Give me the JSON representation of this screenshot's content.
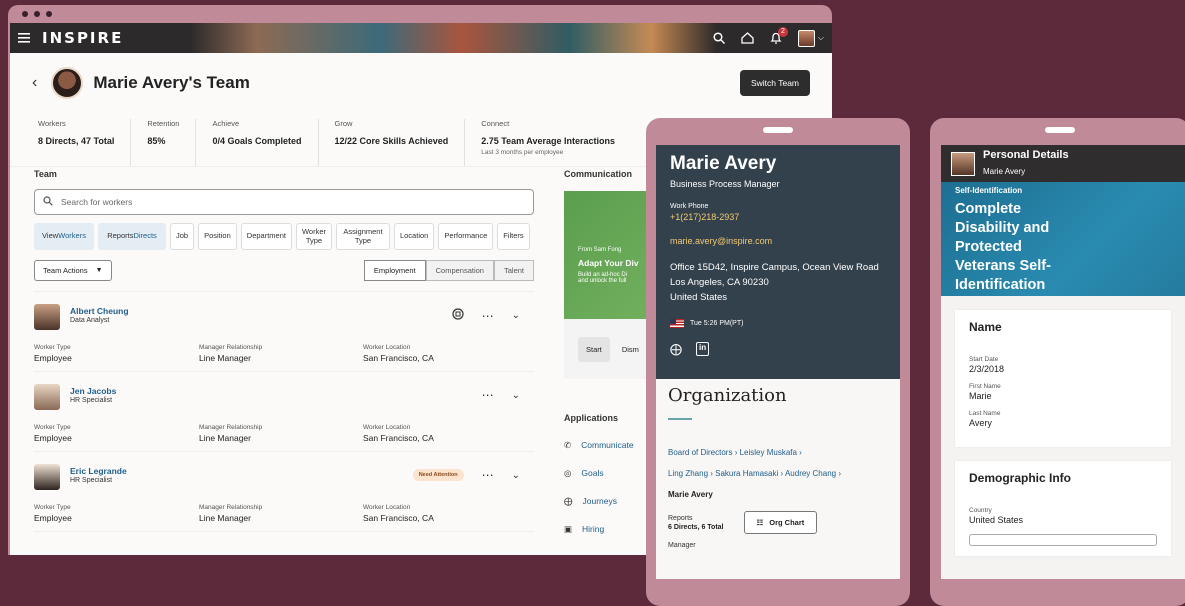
{
  "app": {
    "brand": "INSPIRE",
    "notifications": "2"
  },
  "page": {
    "title": "Marie Avery's Team",
    "switch_label": "Switch Team"
  },
  "stats": [
    {
      "label": "Workers",
      "value": "8 Directs, 47 Total",
      "sub": ""
    },
    {
      "label": "Retention",
      "value": "85%",
      "sub": ""
    },
    {
      "label": "Achieve",
      "value": "0/4 Goals Completed",
      "sub": ""
    },
    {
      "label": "Grow",
      "value": "12/22 Core Skills Achieved",
      "sub": ""
    },
    {
      "label": "Connect",
      "value": "2.75 Team Average Interactions",
      "sub": "Last 3 months per employee"
    }
  ],
  "team": {
    "heading": "Team",
    "search_placeholder": "Search for workers",
    "filters": [
      {
        "pre": "View ",
        "hi": "Workers",
        "active": true
      },
      {
        "pre": "Reports ",
        "hi": "Directs",
        "active": true
      },
      {
        "pre": "Job",
        "hi": "",
        "active": false
      },
      {
        "pre": "Position",
        "hi": "",
        "active": false
      },
      {
        "pre": "Department",
        "hi": "",
        "active": false
      },
      {
        "pre": "Worker Type",
        "hi": "",
        "active": false
      },
      {
        "pre": "Assignment Type",
        "hi": "",
        "active": false
      },
      {
        "pre": "Location",
        "hi": "",
        "active": false
      },
      {
        "pre": "Performance",
        "hi": "",
        "active": false
      },
      {
        "pre": "Filters",
        "hi": "",
        "active": false
      }
    ],
    "actions_label": "Team Actions",
    "tabs": [
      "Employment",
      "Compensation",
      "Talent"
    ],
    "field_labels": {
      "type": "Worker Type",
      "relation": "Manager Relationship",
      "location": "Worker Location"
    },
    "members": [
      {
        "name": "Albert Cheung",
        "job": "Data Analyst",
        "type": "Employee",
        "relation": "Line Manager",
        "location": "San Francisco, CA",
        "badge": ""
      },
      {
        "name": "Jen Jacobs",
        "job": "HR Specialist",
        "type": "Employee",
        "relation": "Line Manager",
        "location": "San Francisco, CA",
        "badge": ""
      },
      {
        "name": "Eric Legrande",
        "job": "HR Specialist",
        "type": "Employee",
        "relation": "Line Manager",
        "location": "San Francisco, CA",
        "badge": "Need Attention"
      }
    ]
  },
  "communication": {
    "heading": "Communication",
    "from": "From Sam Fong",
    "promo_title": "Adapt Your Div",
    "promo_body_1": "Build an ad-hoc Di",
    "promo_body_2": "and unlock the full",
    "start": "Start",
    "dismiss": "Dism"
  },
  "applications": {
    "heading": "Applications",
    "items": [
      "Communicate",
      "Goals",
      "Journeys",
      "Hiring"
    ]
  },
  "profile": {
    "name": "Marie Avery",
    "role": "Business Process Manager",
    "phone_label": "Work Phone",
    "phone": "+1(217)218-2937",
    "email": "marie.avery@inspire.com",
    "addr1": "Office 15D42, Inspire Campus, Ocean View Road",
    "addr2": "Los Angeles, CA 90230",
    "addr3": "United States",
    "time": "Tue 5:26 PM(PT)",
    "org_heading": "Organization",
    "chain1": [
      "Board of Directors",
      "Leisley Muskafa"
    ],
    "chain2": [
      "Ling Zhang",
      "Sakura Hamasaki",
      "Audrey Chang"
    ],
    "self": "Marie Avery",
    "reports_label": "Reports",
    "reports_value": "6 Directs, 6 Total",
    "orgchart_label": "Org Chart",
    "manager_label": "Manager"
  },
  "personal": {
    "title": "Personal Details",
    "subtitle": "Marie Avery",
    "banner_tag": "Self-Identification",
    "banner_title": "Complete Disability and Protected Veterans Self-Identification",
    "name_card": "Name",
    "fields": [
      {
        "label": "Start Date",
        "value": "2/3/2018"
      },
      {
        "label": "First Name",
        "value": "Marie"
      },
      {
        "label": "Last Name",
        "value": "Avery"
      }
    ],
    "demo_card": "Demographic Info",
    "country_label": "Country",
    "country": "United States"
  }
}
